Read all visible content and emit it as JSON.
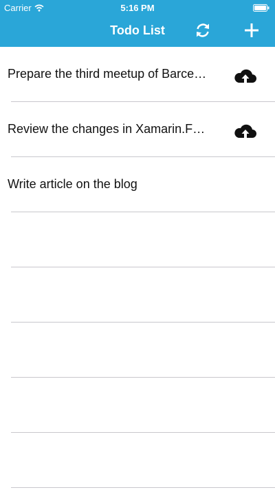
{
  "status_bar": {
    "carrier": "Carrier",
    "time": "5:16 PM"
  },
  "nav": {
    "title": "Todo List",
    "refresh_icon": "refresh-icon",
    "add_icon": "plus-icon"
  },
  "todos": [
    {
      "text": "Prepare the third meetup of Barcelona",
      "synced": false
    },
    {
      "text": "Review the changes in Xamarin.Forms",
      "synced": false
    },
    {
      "text": "Write article on the blog",
      "synced": true
    }
  ],
  "colors": {
    "header": "#2aa6d8",
    "separator": "#c8c7cc",
    "text": "#111111"
  }
}
